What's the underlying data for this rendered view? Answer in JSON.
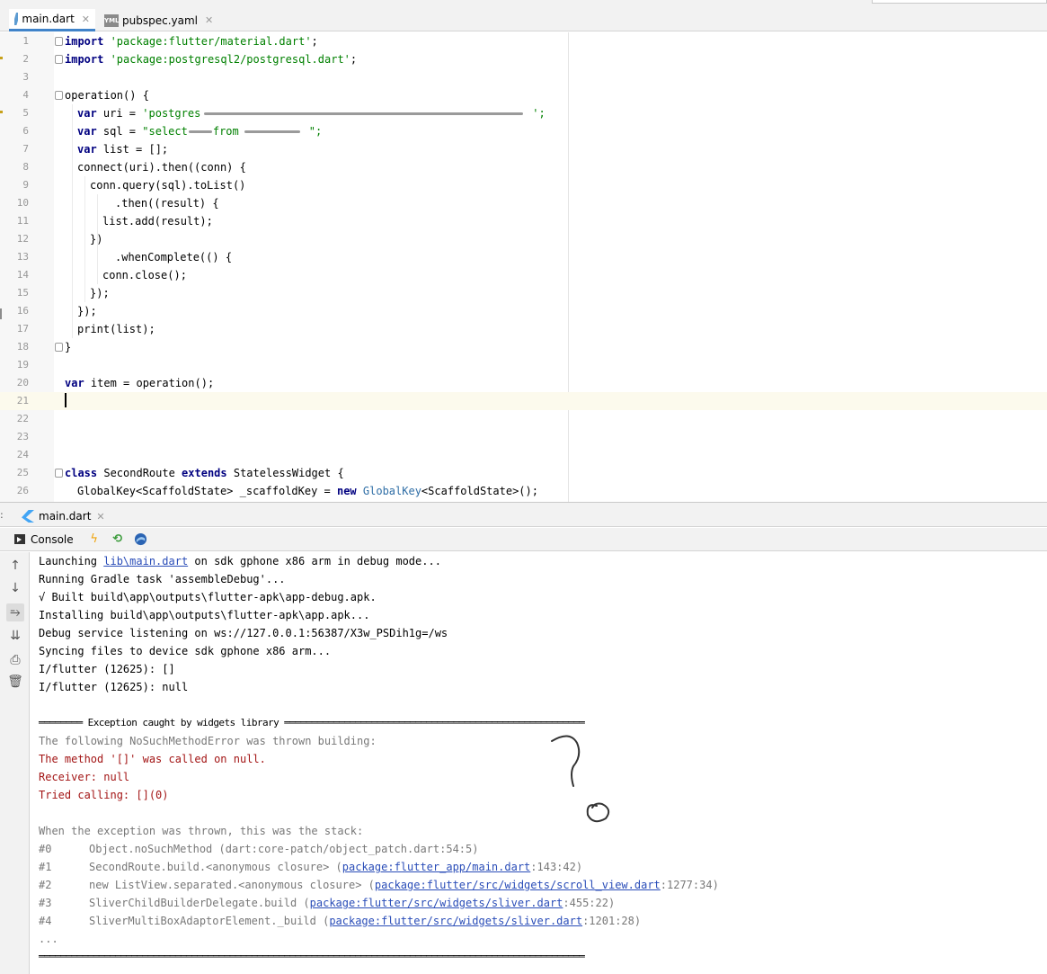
{
  "editor_tabs": [
    {
      "label": "main.dart",
      "icon": "dart-file-icon",
      "active": true
    },
    {
      "label": "pubspec.yaml",
      "icon": "yaml-file-icon",
      "icon_text": "YML",
      "active": false
    }
  ],
  "code_lines": [
    {
      "n": "1"
    },
    {
      "n": "2"
    },
    {
      "n": "3"
    },
    {
      "n": "4"
    },
    {
      "n": "5"
    },
    {
      "n": "6"
    },
    {
      "n": "7"
    },
    {
      "n": "8"
    },
    {
      "n": "9"
    },
    {
      "n": "10"
    },
    {
      "n": "11"
    },
    {
      "n": "12"
    },
    {
      "n": "13"
    },
    {
      "n": "14"
    },
    {
      "n": "15"
    },
    {
      "n": "16"
    },
    {
      "n": "17"
    },
    {
      "n": "18"
    },
    {
      "n": "19"
    },
    {
      "n": "20"
    },
    {
      "n": "21"
    },
    {
      "n": "22"
    },
    {
      "n": "23"
    },
    {
      "n": "24"
    },
    {
      "n": "25"
    },
    {
      "n": "26"
    }
  ],
  "code": {
    "l1_kw": "import",
    "l1_str": " 'package:flutter/material.dart'",
    "l1_end": ";",
    "l2_kw": "import",
    "l2_str": " 'package:postgresql2/postgresql.dart'",
    "l2_end": ";",
    "l4": "operation() {",
    "l5_kw": "var",
    "l5_a": " uri = ",
    "l5_str": "'postgres",
    "l5_end": "';",
    "l6_kw": "var",
    "l6_a": " sql = ",
    "l6_str1": "\"select",
    "l6_str2": "from",
    "l6_end": "\";",
    "l7_kw": "var",
    "l7_a": " list = [];",
    "l8": "connect(uri).then((conn) {",
    "l9": "conn.query(sql).toList()",
    "l10": ".then((result) {",
    "l11": "list.add(result);",
    "l12": "})",
    "l13": ".whenComplete(() {",
    "l14": "conn.close();",
    "l15": "});",
    "l16": "});",
    "l17": "print(list);",
    "l18": "}",
    "l20_kw": "var",
    "l20_a": " item = operation();",
    "l25_kw1": "class",
    "l25_a": " SecondRoute ",
    "l25_kw2": "extends",
    "l25_b": " StatelessWidget {",
    "l26_a": "GlobalKey<ScaffoldState> _scaffoldKey = ",
    "l26_kw": "new",
    "l26_cls": " GlobalKey",
    "l26_b": "<ScaffoldState>();"
  },
  "run_tab": {
    "label": "main.dart",
    "icon": "flutter-icon"
  },
  "console_bar": {
    "label": "Console",
    "tools": [
      "lightning-icon",
      "hot-restart-icon",
      "devtools-icon"
    ]
  },
  "side_tools": [
    "arrow-up-icon",
    "arrow-down-icon",
    "soft-wrap-icon",
    "scroll-to-end-icon",
    "print-icon",
    "trash-icon"
  ],
  "console": {
    "l1_a": "Launching ",
    "l1_link": "lib\\main.dart",
    "l1_b": " on sdk gphone x86 arm in debug mode...",
    "l2": "Running Gradle task 'assembleDebug'...",
    "l3": "√ Built build\\app\\outputs\\flutter-apk\\app-debug.apk.",
    "l4": "Installing build\\app\\outputs\\flutter-apk\\app.apk...",
    "l5": "Debug service listening on ws://127.0.0.1:56387/X3w_PSDih1g=/ws",
    "l6": "Syncing files to device sdk gphone x86 arm...",
    "l7": "I/flutter (12625): []",
    "l8": "I/flutter (12625): null",
    "l10": "════════ Exception caught by widgets library ═══════════════════════════════════════════════════════",
    "l11": "The following NoSuchMethodError was thrown building:",
    "l12": "The method '[]' was called on null.",
    "l13": "Receiver: null",
    "l14": "Tried calling: [](0)",
    "l16": "When the exception was thrown, this was the stack:",
    "frames": [
      {
        "no": "#0",
        "text": "Object.noSuchMethod (dart:core-patch/object_patch.dart:54:5)",
        "link": "",
        "tail": ""
      },
      {
        "no": "#1",
        "text": "SecondRoute.build.<anonymous closure> (",
        "link": "package:flutter_app/main.dart",
        "tail": ":143:42)"
      },
      {
        "no": "#2",
        "text": "new ListView.separated.<anonymous closure> (",
        "link": "package:flutter/src/widgets/scroll_view.dart",
        "tail": ":1277:34)"
      },
      {
        "no": "#3",
        "text": "SliverChildBuilderDelegate.build (",
        "link": "package:flutter/src/widgets/sliver.dart",
        "tail": ":455:22)"
      },
      {
        "no": "#4",
        "text": "SliverMultiBoxAdaptorElement._build (",
        "link": "package:flutter/src/widgets/sliver.dart",
        "tail": ":1201:28)"
      }
    ],
    "l22": "...",
    "l23": "════════════════════════════════════════════════════════════════════════════════════════════════════"
  }
}
